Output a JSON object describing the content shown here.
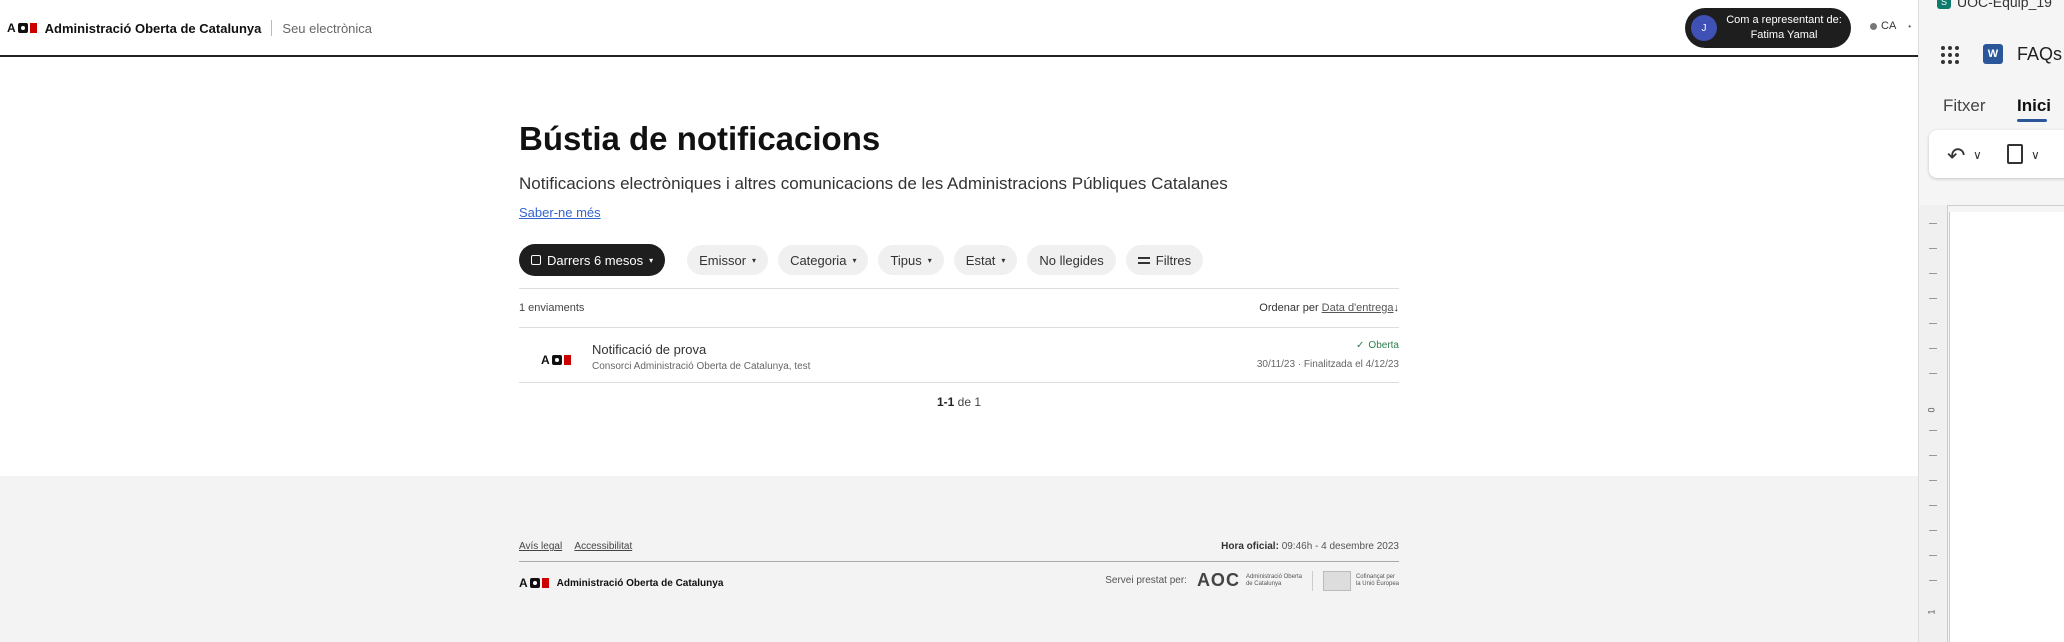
{
  "header": {
    "brand": "Administració Oberta de Catalunya",
    "seu": "Seu electrònica",
    "representative": {
      "avatar_initial": "J",
      "line1": "Com a representant de:",
      "line2": "Fatima Yamal"
    },
    "language": "CA"
  },
  "main": {
    "title": "Bústia de notificacions",
    "subtitle": "Notificacions electròniques i altres comunicacions de les Administracions Públiques Catalanes",
    "learn_more": "Saber-ne més",
    "filters": {
      "period": "Darrers 6 mesos",
      "emissor": "Emissor",
      "categoria": "Categoria",
      "tipus": "Tipus",
      "estat": "Estat",
      "no_llegides": "No llegides",
      "filtres": "Filtres"
    },
    "count": "1 enviaments",
    "sort_label": "Ordenar per",
    "sort_field": "Data d'entrega",
    "sort_arrow": "↓",
    "notifications": [
      {
        "title": "Notificació de prova",
        "sender": "Consorci Administració Oberta de Catalunya, test",
        "status": "Oberta",
        "date": "30/11/23 · Finalitzada el 4/12/23"
      }
    ],
    "pagination": {
      "range": "1-1",
      "of": "de 1"
    }
  },
  "footer": {
    "links": [
      "Avís legal",
      "Accessibilitat"
    ],
    "hora_label": "Hora oficial:",
    "hora_value": "09:46h - 4 desembre 2023",
    "brand": "Administració Oberta de Catalunya",
    "servei": "Servei prestat per:",
    "aoc_letters": "AOC",
    "aoc_name_1": "Administració Oberta",
    "aoc_name_2": "de Catalunya",
    "eu_line_1": "Cofinançat per",
    "eu_line_2": "la Unió Europea"
  },
  "word_panel": {
    "top_title": "UOC-Equip_19",
    "doc_title": "FAQs",
    "tab_file": "Fitxer",
    "tab_home": "Inici",
    "ruler_zero": "0",
    "ruler_one": "1"
  },
  "colors": {
    "dark": "#1e1e1e",
    "link": "#3366cc",
    "status_green": "#2e7d4f",
    "aoc_red": "#cc0000",
    "word_blue": "#2b579a"
  }
}
